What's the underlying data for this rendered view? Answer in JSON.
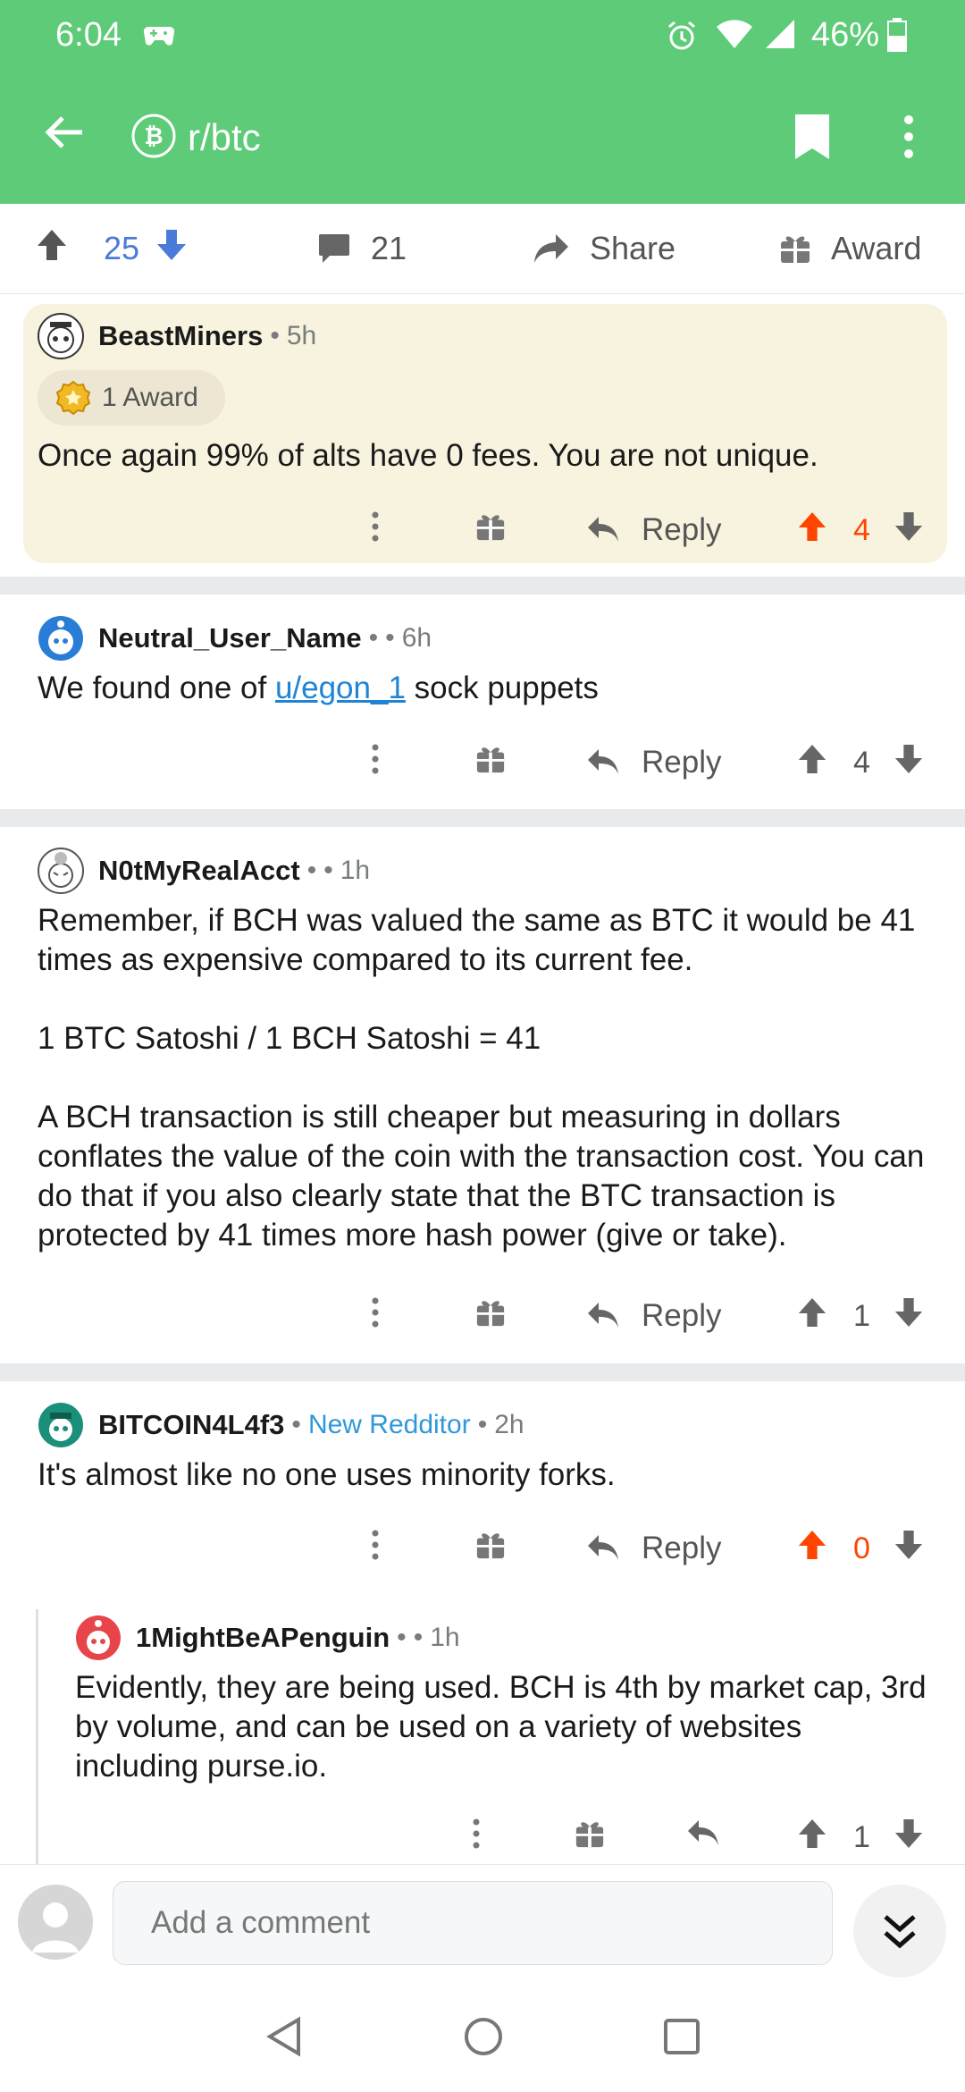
{
  "status_bar": {
    "time": "6:04",
    "battery": "46%"
  },
  "app_bar": {
    "subreddit": "r/btc"
  },
  "post_actions": {
    "score": "25",
    "comments": "21",
    "share_label": "Share",
    "award_label": "Award"
  },
  "comments": [
    {
      "user": "BeastMiners",
      "time": "5h",
      "award_text": "1 Award",
      "body": "Once again 99% of alts have 0 fees. You are not unique.",
      "reply_label": "Reply",
      "score": "4",
      "upvoted": true
    },
    {
      "user": "Neutral_User_Name",
      "time": "6h",
      "body_before": "We found one of ",
      "body_link": "u/egon_1",
      "body_after": " sock puppets",
      "reply_label": "Reply",
      "score": "4"
    },
    {
      "user": "N0tMyRealAcct",
      "time": "1h",
      "paragraphs": [
        "Remember, if BCH was valued the same as BTC it would be 41 times as expensive compared to its current fee.",
        "1 BTC Satoshi / 1 BCH Satoshi = 41",
        "A BCH transaction is still cheaper but measuring in dollars conflates the value of the coin with the transaction cost. You can do that if you also clearly state that the BTC transaction is protected by 41 times more hash power (give or take)."
      ],
      "reply_label": "Reply",
      "score": "1"
    },
    {
      "user": "BITCOIN4L4f3",
      "flair": "New Redditor",
      "time": "2h",
      "body": "It's almost like no one uses minority forks.",
      "reply_label": "Reply",
      "score": "0",
      "upvoted": true
    },
    {
      "user": "1MightBeAPenguin",
      "time": "1h",
      "body": "Evidently, they are being used. BCH is 4th by market cap, 3rd by volume, and can be used on a variety of websites including purse.io.",
      "score": "1"
    }
  ],
  "compose": {
    "placeholder": "Add a comment"
  },
  "colors": {
    "header": "#5ecb78",
    "upvote_active": "#ff4500",
    "link": "#1f84d6",
    "flair": "#2f98d9",
    "award_card": "#f8f3de"
  }
}
